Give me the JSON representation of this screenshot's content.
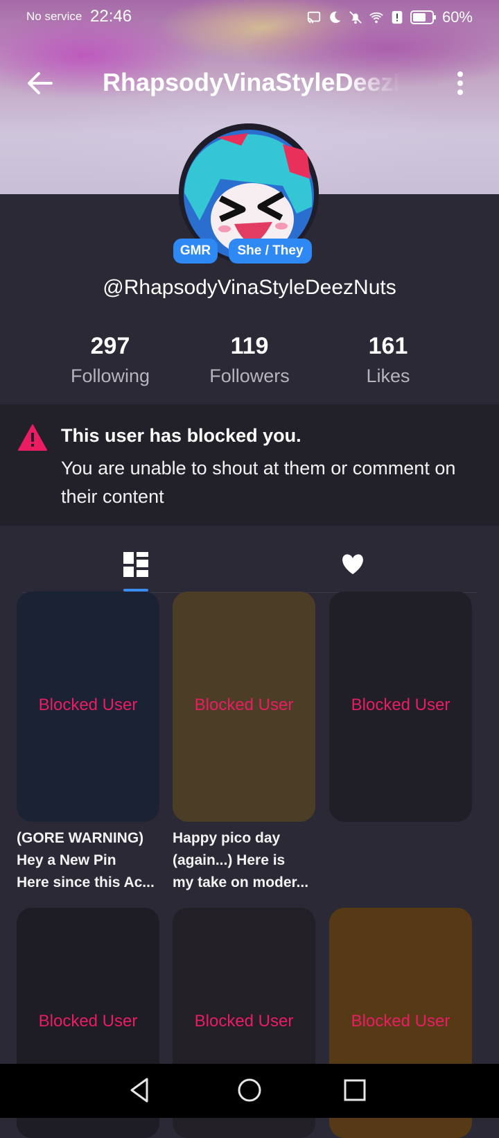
{
  "status_bar": {
    "carrier": "No service",
    "time": "22:46",
    "battery_percent": "60%",
    "icons": [
      "cast-icon",
      "moon-icon",
      "bell-off-icon",
      "wifi-icon",
      "alert-icon",
      "battery-icon"
    ]
  },
  "header": {
    "title": "RhapsodyVinaStyleDeezNuts",
    "back_icon": "arrow-left-icon",
    "menu_icon": "more-vertical-icon"
  },
  "profile": {
    "badges": [
      "GMR",
      "She / They"
    ],
    "username": "@RhapsodyVinaStyleDeezNuts",
    "stats": [
      {
        "value": "297",
        "label": "Following"
      },
      {
        "value": "119",
        "label": "Followers"
      },
      {
        "value": "161",
        "label": "Likes"
      }
    ]
  },
  "blocked_notice": {
    "title": "This user has blocked you.",
    "message": "You are unable to shout at them or comment on their content",
    "icon": "warning-icon"
  },
  "tabs": [
    {
      "name": "posts",
      "icon": "grid-icon",
      "active": true
    },
    {
      "name": "likes",
      "icon": "heart-icon",
      "active": false
    }
  ],
  "grid": {
    "label": "Blocked User",
    "cards": [
      {
        "label": "Blocked User",
        "color": "#1a2233",
        "caption": [
          "(GORE WARNING)",
          "Hey a New Pin",
          "Here since this Ac..."
        ]
      },
      {
        "label": "Blocked User",
        "color": "#4c3e26",
        "caption": [
          "Happy pico day",
          "(again...) Here is",
          "my take on moder..."
        ]
      },
      {
        "label": "Blocked User",
        "color": "#201f27",
        "caption": []
      },
      {
        "label": "Blocked User",
        "color": "#1e1c25",
        "caption": []
      },
      {
        "label": "Blocked User",
        "color": "#221f27",
        "caption": []
      },
      {
        "label": "Blocked User",
        "color": "#563a15",
        "caption": []
      }
    ]
  },
  "colors": {
    "background": "#2a2935",
    "notice_bg": "#22212a",
    "accent_blue": "#2f89f5",
    "blocked_red": "#ea1d63"
  },
  "nav_bar": {
    "buttons": [
      "back-triangle-icon",
      "home-circle-icon",
      "recents-square-icon"
    ]
  }
}
